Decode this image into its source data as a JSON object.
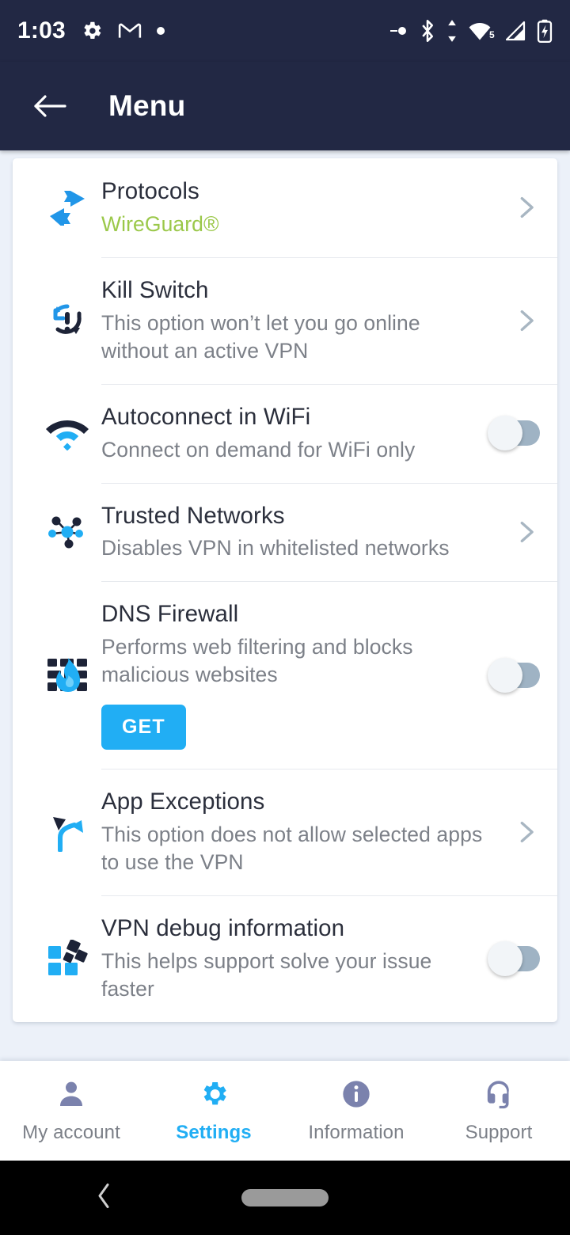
{
  "status_bar": {
    "time": "1:03",
    "left_icons": [
      "gear-icon",
      "gmail-icon",
      "dot-icon"
    ],
    "right_icons": [
      "location-dot-icon",
      "bluetooth-icon",
      "data-transfer-icon",
      "wifi-icon",
      "cell-signal-icon",
      "battery-charging-icon"
    ],
    "wifi_badge": "5"
  },
  "app_bar": {
    "back_label": "Back",
    "title": "Menu"
  },
  "colors": {
    "header_bg": "#222844",
    "page_bg": "#ecf1f9",
    "accent_blue": "#21AEF4",
    "accent_green": "#9bc84a",
    "title_text": "#2b2f3c",
    "sub_text": "#7c8088",
    "chevron": "#a8b6c2",
    "toggle_track": "#9fb3c4",
    "toggle_thumb": "#f2f5f8"
  },
  "menu": {
    "items": [
      {
        "id": "protocols",
        "icon": "exchange-arrows-icon",
        "title": "Protocols",
        "subtitle": "WireGuard®",
        "subtitle_style": "accent",
        "control": "chevron"
      },
      {
        "id": "kill-switch",
        "icon": "kill-switch-icon",
        "title": "Kill Switch",
        "subtitle": "This option won’t let you go online without an active VPN",
        "subtitle_style": "normal",
        "control": "chevron"
      },
      {
        "id": "autoconnect-wifi",
        "icon": "wifi-signal-icon",
        "title": "Autoconnect in WiFi",
        "subtitle": "Connect on demand for WiFi only",
        "subtitle_style": "normal",
        "control": "toggle",
        "toggle_state": "off"
      },
      {
        "id": "trusted-networks",
        "icon": "network-hub-icon",
        "title": "Trusted Networks",
        "subtitle": "Disables VPN in whitelisted networks",
        "subtitle_style": "normal",
        "control": "chevron"
      },
      {
        "id": "dns-firewall",
        "icon": "firewall-flame-icon",
        "title": "DNS Firewall",
        "subtitle": "Performs web filtering and blocks malicious websites",
        "subtitle_style": "normal",
        "control": "toggle",
        "toggle_state": "off",
        "button_label": "GET"
      },
      {
        "id": "app-exceptions",
        "icon": "branching-arrows-icon",
        "title": "App Exceptions",
        "subtitle": "This option does not allow selected apps to use the VPN",
        "subtitle_style": "normal",
        "control": "chevron"
      },
      {
        "id": "vpn-debug",
        "icon": "blocks-icon",
        "title": "VPN debug information",
        "subtitle": "This helps support solve your issue faster",
        "subtitle_style": "normal",
        "control": "toggle",
        "toggle_state": "off"
      }
    ]
  },
  "bottom_nav": {
    "items": [
      {
        "id": "my-account",
        "icon": "person-icon",
        "label": "My account",
        "active": false
      },
      {
        "id": "settings",
        "icon": "gear-icon",
        "label": "Settings",
        "active": true
      },
      {
        "id": "information",
        "icon": "info-circle-icon",
        "label": "Information",
        "active": false
      },
      {
        "id": "support",
        "icon": "headset-icon",
        "label": "Support",
        "active": false
      }
    ]
  },
  "android_nav": {
    "back": "back-chevron-icon",
    "home": "home-pill-icon"
  }
}
